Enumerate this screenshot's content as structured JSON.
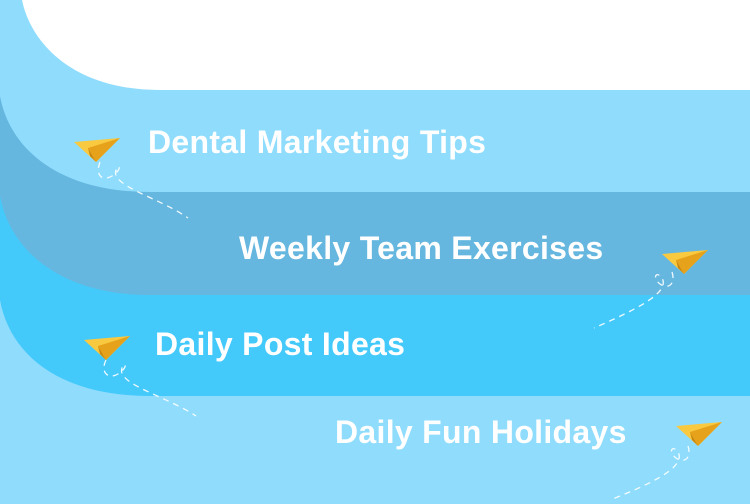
{
  "colors": {
    "background": "#ffffff",
    "band_1": "#8fdcfd",
    "band_2": "#66b7df",
    "band_3": "#44c9fb",
    "band_4": "#8fdcfd",
    "text": "#ffffff",
    "plane_light": "#f9c940",
    "plane_dark": "#e6a21b",
    "dash": "#ffffff"
  },
  "items": [
    {
      "label": "Dental Marketing Tips",
      "icon": "paper-plane-icon"
    },
    {
      "label": "Weekly Team Exercises",
      "icon": "paper-plane-icon"
    },
    {
      "label": "Daily Post Ideas",
      "icon": "paper-plane-icon"
    },
    {
      "label": "Daily Fun Holidays",
      "icon": "paper-plane-icon"
    }
  ]
}
